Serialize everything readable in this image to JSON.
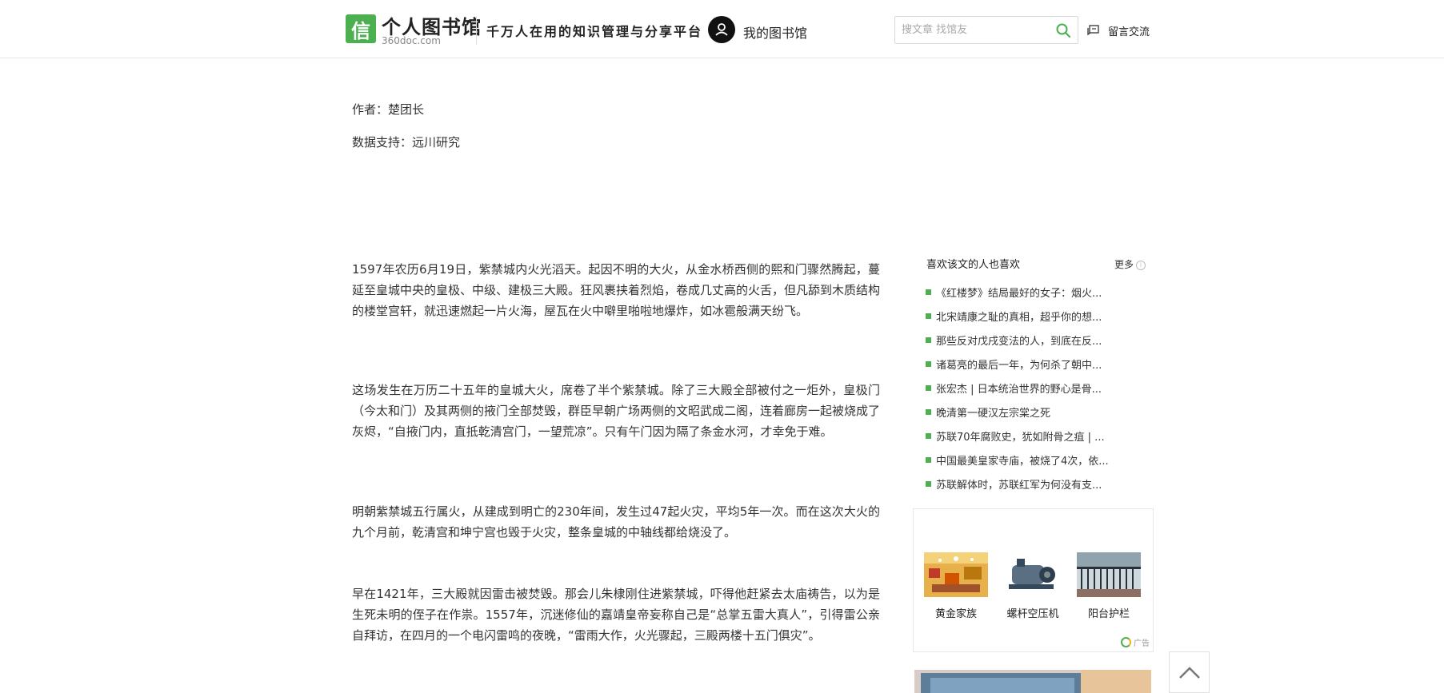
{
  "header": {
    "logo_glyph": "信",
    "site_name": "个人图书馆",
    "site_domain": "360doc.com",
    "slogan": "千万人在用的知识管理与分享平台",
    "my_library": "我的图书馆",
    "search_placeholder": "搜文章 找馆友",
    "message": "留言交流"
  },
  "article": {
    "author": "作者：楚团长",
    "data_support": "数据支持：远川研究",
    "paragraphs": [
      "1597年农历6月19日，紫禁城内火光滔天。起因不明的大火，从金水桥西侧的熙和门骤然腾起，蔓延至皇城中央的皇极、中级、建极三大殿。狂风裹挟着烈焰，卷成几丈高的火舌，但凡舔到木质结构的楼堂宫轩，就迅速燃起一片火海，屋瓦在火中噼里啪啦地爆炸，如冰雹般满天纷飞。",
      "这场发生在万历二十五年的皇城大火，席卷了半个紫禁城。除了三大殿全部被付之一炬外，皇极门（今太和门）及其两侧的掖门全部焚毁，群臣早朝广场两侧的文昭武成二阁，连着廊房一起被烧成了灰烬，“自掖门内，直抵乾清宫门，一望荒凉”。只有午门因为隔了条金水河，才幸免于难。",
      "明朝紫禁城五行属火，从建成到明亡的230年间，发生过47起火灾，平均5年一次。而在这次大火的九个月前，乾清宫和坤宁宫也毁于火灾，整条皇城的中轴线都给烧没了。",
      "早在1421年，三大殿就因雷击被焚毁。那会儿朱棣刚住进紫禁城，吓得他赶紧去太庙祷告，以为是生死未明的侄子在作祟。1557年，沉迷修仙的嘉靖皇帝妄称自己是“总掌五雷大真人”，引得雷公亲自拜访，在四月的一个电闪雷鸣的夜晚，“雷雨大作，火光骤起，三殿两楼十五门俱灾”。"
    ]
  },
  "sidebar": {
    "title": "喜欢该文的人也喜欢",
    "more": "更多",
    "more_icon": "i",
    "items": [
      "《红楼梦》结局最好的女子：烟火...",
      "北宋靖康之耻的真相，超乎你的想...",
      "那些反对戊戌变法的人，到底在反...",
      "诸葛亮的最后一年，为何杀了朝中...",
      "张宏杰 | 日本统治世界的野心是骨...",
      "晚清第一硬汉左宗棠之死",
      "苏联70年腐败史，犹如附骨之疽 | ...",
      "中国最美皇家寺庙，被烧了4次，依...",
      "苏联解体时，苏联红军为何没有支..."
    ],
    "ads": [
      "黄金家族",
      "螺杆空压机",
      "阳台护栏"
    ],
    "ad_badge": "广告"
  },
  "colors": {
    "accent": "#4caf50"
  }
}
